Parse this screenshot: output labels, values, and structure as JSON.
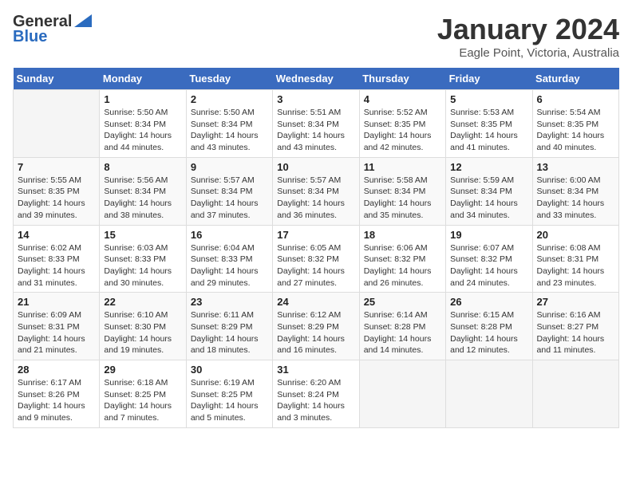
{
  "logo": {
    "general": "General",
    "blue": "Blue"
  },
  "header": {
    "title": "January 2024",
    "subtitle": "Eagle Point, Victoria, Australia"
  },
  "calendar": {
    "days_of_week": [
      "Sunday",
      "Monday",
      "Tuesday",
      "Wednesday",
      "Thursday",
      "Friday",
      "Saturday"
    ],
    "weeks": [
      [
        {
          "day": "",
          "info": ""
        },
        {
          "day": "1",
          "info": "Sunrise: 5:50 AM\nSunset: 8:34 PM\nDaylight: 14 hours\nand 44 minutes."
        },
        {
          "day": "2",
          "info": "Sunrise: 5:50 AM\nSunset: 8:34 PM\nDaylight: 14 hours\nand 43 minutes."
        },
        {
          "day": "3",
          "info": "Sunrise: 5:51 AM\nSunset: 8:34 PM\nDaylight: 14 hours\nand 43 minutes."
        },
        {
          "day": "4",
          "info": "Sunrise: 5:52 AM\nSunset: 8:35 PM\nDaylight: 14 hours\nand 42 minutes."
        },
        {
          "day": "5",
          "info": "Sunrise: 5:53 AM\nSunset: 8:35 PM\nDaylight: 14 hours\nand 41 minutes."
        },
        {
          "day": "6",
          "info": "Sunrise: 5:54 AM\nSunset: 8:35 PM\nDaylight: 14 hours\nand 40 minutes."
        }
      ],
      [
        {
          "day": "7",
          "info": "Sunrise: 5:55 AM\nSunset: 8:35 PM\nDaylight: 14 hours\nand 39 minutes."
        },
        {
          "day": "8",
          "info": "Sunrise: 5:56 AM\nSunset: 8:34 PM\nDaylight: 14 hours\nand 38 minutes."
        },
        {
          "day": "9",
          "info": "Sunrise: 5:57 AM\nSunset: 8:34 PM\nDaylight: 14 hours\nand 37 minutes."
        },
        {
          "day": "10",
          "info": "Sunrise: 5:57 AM\nSunset: 8:34 PM\nDaylight: 14 hours\nand 36 minutes."
        },
        {
          "day": "11",
          "info": "Sunrise: 5:58 AM\nSunset: 8:34 PM\nDaylight: 14 hours\nand 35 minutes."
        },
        {
          "day": "12",
          "info": "Sunrise: 5:59 AM\nSunset: 8:34 PM\nDaylight: 14 hours\nand 34 minutes."
        },
        {
          "day": "13",
          "info": "Sunrise: 6:00 AM\nSunset: 8:34 PM\nDaylight: 14 hours\nand 33 minutes."
        }
      ],
      [
        {
          "day": "14",
          "info": "Sunrise: 6:02 AM\nSunset: 8:33 PM\nDaylight: 14 hours\nand 31 minutes."
        },
        {
          "day": "15",
          "info": "Sunrise: 6:03 AM\nSunset: 8:33 PM\nDaylight: 14 hours\nand 30 minutes."
        },
        {
          "day": "16",
          "info": "Sunrise: 6:04 AM\nSunset: 8:33 PM\nDaylight: 14 hours\nand 29 minutes."
        },
        {
          "day": "17",
          "info": "Sunrise: 6:05 AM\nSunset: 8:32 PM\nDaylight: 14 hours\nand 27 minutes."
        },
        {
          "day": "18",
          "info": "Sunrise: 6:06 AM\nSunset: 8:32 PM\nDaylight: 14 hours\nand 26 minutes."
        },
        {
          "day": "19",
          "info": "Sunrise: 6:07 AM\nSunset: 8:32 PM\nDaylight: 14 hours\nand 24 minutes."
        },
        {
          "day": "20",
          "info": "Sunrise: 6:08 AM\nSunset: 8:31 PM\nDaylight: 14 hours\nand 23 minutes."
        }
      ],
      [
        {
          "day": "21",
          "info": "Sunrise: 6:09 AM\nSunset: 8:31 PM\nDaylight: 14 hours\nand 21 minutes."
        },
        {
          "day": "22",
          "info": "Sunrise: 6:10 AM\nSunset: 8:30 PM\nDaylight: 14 hours\nand 19 minutes."
        },
        {
          "day": "23",
          "info": "Sunrise: 6:11 AM\nSunset: 8:29 PM\nDaylight: 14 hours\nand 18 minutes."
        },
        {
          "day": "24",
          "info": "Sunrise: 6:12 AM\nSunset: 8:29 PM\nDaylight: 14 hours\nand 16 minutes."
        },
        {
          "day": "25",
          "info": "Sunrise: 6:14 AM\nSunset: 8:28 PM\nDaylight: 14 hours\nand 14 minutes."
        },
        {
          "day": "26",
          "info": "Sunrise: 6:15 AM\nSunset: 8:28 PM\nDaylight: 14 hours\nand 12 minutes."
        },
        {
          "day": "27",
          "info": "Sunrise: 6:16 AM\nSunset: 8:27 PM\nDaylight: 14 hours\nand 11 minutes."
        }
      ],
      [
        {
          "day": "28",
          "info": "Sunrise: 6:17 AM\nSunset: 8:26 PM\nDaylight: 14 hours\nand 9 minutes."
        },
        {
          "day": "29",
          "info": "Sunrise: 6:18 AM\nSunset: 8:25 PM\nDaylight: 14 hours\nand 7 minutes."
        },
        {
          "day": "30",
          "info": "Sunrise: 6:19 AM\nSunset: 8:25 PM\nDaylight: 14 hours\nand 5 minutes."
        },
        {
          "day": "31",
          "info": "Sunrise: 6:20 AM\nSunset: 8:24 PM\nDaylight: 14 hours\nand 3 minutes."
        },
        {
          "day": "",
          "info": ""
        },
        {
          "day": "",
          "info": ""
        },
        {
          "day": "",
          "info": ""
        }
      ]
    ]
  }
}
